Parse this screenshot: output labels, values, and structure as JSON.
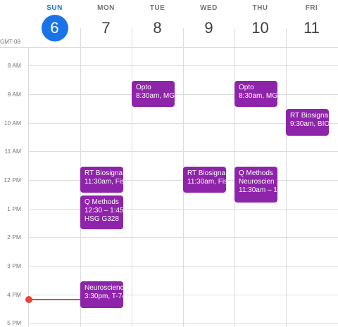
{
  "calendar": {
    "timezone": "GMT-08",
    "days": [
      {
        "name": "SUN",
        "num": "6",
        "today": true
      },
      {
        "name": "MON",
        "num": "7"
      },
      {
        "name": "TUE",
        "num": "8"
      },
      {
        "name": "WED",
        "num": "9"
      },
      {
        "name": "THU",
        "num": "10"
      },
      {
        "name": "FRI",
        "num": "11"
      }
    ],
    "hours": [
      "8 AM",
      "9 AM",
      "10 AM",
      "11 AM",
      "12 PM",
      "1 PM",
      "2 PM",
      "3 PM",
      "4 PM",
      "5 PM"
    ],
    "events": [
      {
        "day": 2,
        "lines": [
          "Opto",
          "8:30am, MG"
        ]
      },
      {
        "day": 4,
        "lines": [
          "Opto",
          "8:30am, MG"
        ]
      },
      {
        "day": 5,
        "lines": [
          "RT Biosigna",
          "9:30am, BIO"
        ]
      },
      {
        "day": 1,
        "lines": [
          "RT Biosigna",
          "11:30am, Fis"
        ]
      },
      {
        "day": 3,
        "lines": [
          "RT Biosigna",
          "11:30am, Fis"
        ]
      },
      {
        "day": 4,
        "lines": [
          "Q Methods",
          "Neuroscien",
          "11:30am – 1"
        ]
      },
      {
        "day": 1,
        "lines": [
          "Q Methods",
          "12:30 – 1:45",
          "HSG G328"
        ]
      },
      {
        "day": 1,
        "lines": [
          "Neuroscienc",
          "3:30pm, T-74"
        ]
      }
    ],
    "colors": {
      "accent": "#1a73e8",
      "event": "#8e24aa",
      "now": "#ea4335"
    }
  }
}
